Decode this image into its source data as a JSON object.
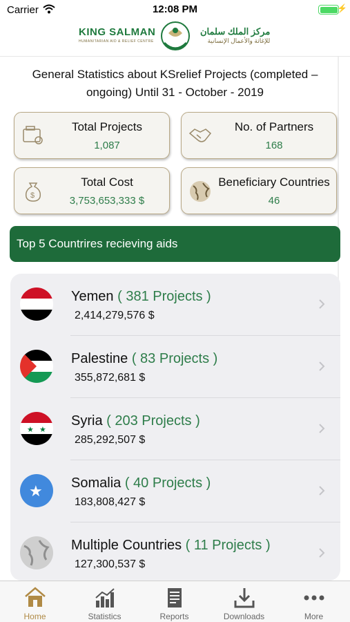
{
  "status_bar": {
    "carrier": "Carrier",
    "time": "12:08 PM"
  },
  "header": {
    "logo_en_title": "KING SALMAN",
    "logo_en_subtitle": "HUMANITARIAN AID & RELIEF CENTRE",
    "logo_ar_title": "مركز الملك سلمان",
    "logo_ar_subtitle": "للإغاثة والأعمال الإنسانية"
  },
  "headline": "General Statistics about KSrelief Projects (completed – ongoing) Until 31 - October - 2019",
  "stats": [
    {
      "label": "Total Projects",
      "value": "1,087",
      "icon": "projects-icon"
    },
    {
      "label": "No. of Partners",
      "value": "168",
      "icon": "handshake-icon"
    },
    {
      "label": "Total Cost",
      "value": "3,753,653,333 $",
      "icon": "money-bag-icon"
    },
    {
      "label": "Beneficiary Countries",
      "value": "46",
      "icon": "globe-icon"
    }
  ],
  "banner": {
    "title": "Top 5 Countrires recieving aids"
  },
  "countries": [
    {
      "name": "Yemen",
      "projects": "( 381 Projects )",
      "amount": "2,414,279,576 $"
    },
    {
      "name": "Palestine",
      "projects": "( 83 Projects )",
      "amount": "355,872,681 $"
    },
    {
      "name": "Syria",
      "projects": "( 203 Projects )",
      "amount": "285,292,507 $"
    },
    {
      "name": "Somalia",
      "projects": "( 40 Projects )",
      "amount": "183,808,427 $"
    },
    {
      "name": "Multiple Countries",
      "projects": "( 11 Projects )",
      "amount": "127,300,537 $"
    }
  ],
  "tabs": [
    {
      "label": "Home",
      "icon": "home-icon",
      "active": true
    },
    {
      "label": "Statistics",
      "icon": "bar-chart-icon",
      "active": false
    },
    {
      "label": "Reports",
      "icon": "document-icon",
      "active": false
    },
    {
      "label": "Downloads",
      "icon": "download-icon",
      "active": false
    },
    {
      "label": "More",
      "icon": "more-dots-icon",
      "active": false
    }
  ],
  "colors": {
    "accent_green": "#1e6b3a",
    "value_green": "#2e7d4a",
    "gold": "#b08a45",
    "card_border": "#b8a886"
  }
}
